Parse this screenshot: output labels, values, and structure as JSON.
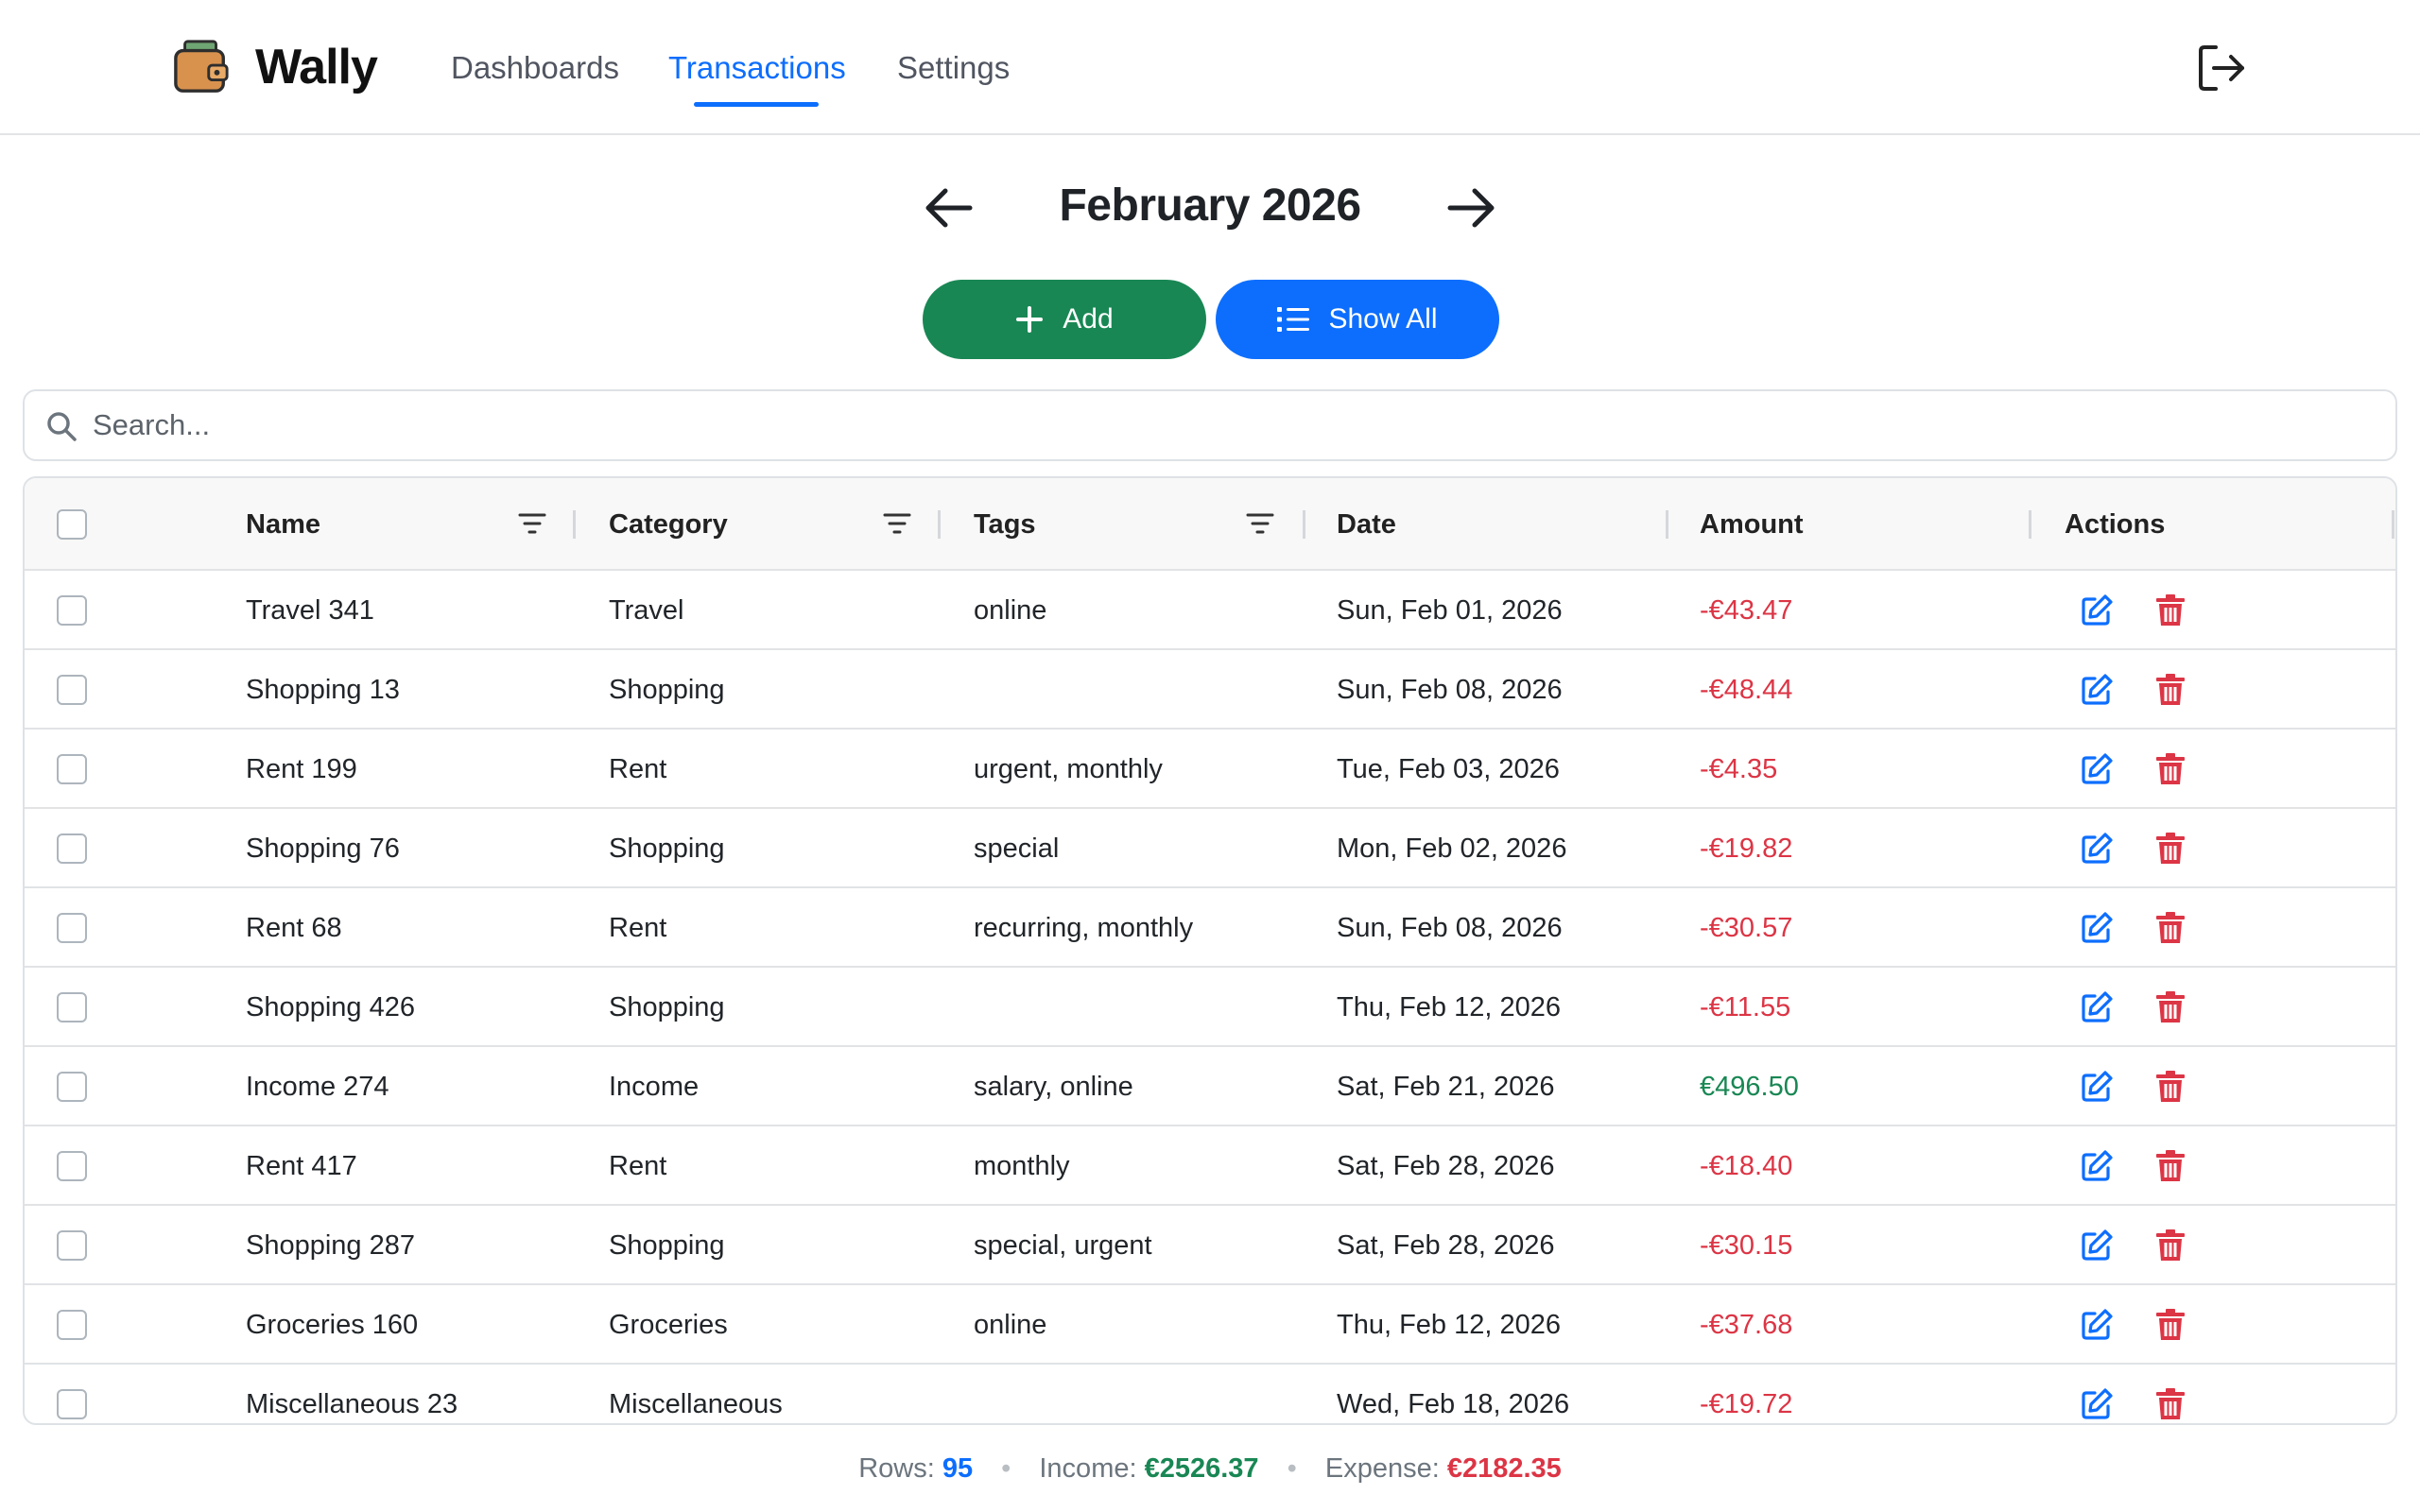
{
  "app": {
    "name": "Wally",
    "icon": "wallet-icon"
  },
  "nav": {
    "items": [
      {
        "label": "Dashboards",
        "active": false
      },
      {
        "label": "Transactions",
        "active": true
      },
      {
        "label": "Settings",
        "active": false
      }
    ],
    "logout_icon": "logout-icon"
  },
  "month": {
    "title": "February 2026",
    "prev_icon": "arrow-left-icon",
    "next_icon": "arrow-right-icon"
  },
  "actions": {
    "add_label": "Add",
    "show_all_label": "Show All"
  },
  "search": {
    "placeholder": "Search...",
    "value": ""
  },
  "table": {
    "columns": [
      {
        "label": "Name",
        "filter": true
      },
      {
        "label": "Category",
        "filter": true
      },
      {
        "label": "Tags",
        "filter": true
      },
      {
        "label": "Date",
        "filter": false
      },
      {
        "label": "Amount",
        "filter": false
      },
      {
        "label": "Actions",
        "filter": false
      }
    ],
    "rows": [
      {
        "name": "Travel 341",
        "category": "Travel",
        "tags": "online",
        "date": "Sun, Feb 01, 2026",
        "amount": "-€43.47",
        "type": "expense"
      },
      {
        "name": "Shopping 13",
        "category": "Shopping",
        "tags": "",
        "date": "Sun, Feb 08, 2026",
        "amount": "-€48.44",
        "type": "expense"
      },
      {
        "name": "Rent 199",
        "category": "Rent",
        "tags": "urgent, monthly",
        "date": "Tue, Feb 03, 2026",
        "amount": "-€4.35",
        "type": "expense"
      },
      {
        "name": "Shopping 76",
        "category": "Shopping",
        "tags": "special",
        "date": "Mon, Feb 02, 2026",
        "amount": "-€19.82",
        "type": "expense"
      },
      {
        "name": "Rent 68",
        "category": "Rent",
        "tags": "recurring, monthly",
        "date": "Sun, Feb 08, 2026",
        "amount": "-€30.57",
        "type": "expense"
      },
      {
        "name": "Shopping 426",
        "category": "Shopping",
        "tags": "",
        "date": "Thu, Feb 12, 2026",
        "amount": "-€11.55",
        "type": "expense"
      },
      {
        "name": "Income 274",
        "category": "Income",
        "tags": "salary, online",
        "date": "Sat, Feb 21, 2026",
        "amount": "€496.50",
        "type": "income"
      },
      {
        "name": "Rent 417",
        "category": "Rent",
        "tags": "monthly",
        "date": "Sat, Feb 28, 2026",
        "amount": "-€18.40",
        "type": "expense"
      },
      {
        "name": "Shopping 287",
        "category": "Shopping",
        "tags": "special, urgent",
        "date": "Sat, Feb 28, 2026",
        "amount": "-€30.15",
        "type": "expense"
      },
      {
        "name": "Groceries 160",
        "category": "Groceries",
        "tags": "online",
        "date": "Thu, Feb 12, 2026",
        "amount": "-€37.68",
        "type": "expense"
      },
      {
        "name": "Miscellaneous 23",
        "category": "Miscellaneous",
        "tags": "",
        "date": "Wed, Feb 18, 2026",
        "amount": "-€19.72",
        "type": "expense"
      }
    ]
  },
  "summary": {
    "rows_label": "Rows:",
    "rows_value": "95",
    "income_label": "Income:",
    "income_value": "€2526.37",
    "expense_label": "Expense:",
    "expense_value": "€2182.35",
    "separator": "•"
  },
  "colors": {
    "primary": "#0d6efd",
    "success": "#198754",
    "danger": "#dc3545"
  }
}
